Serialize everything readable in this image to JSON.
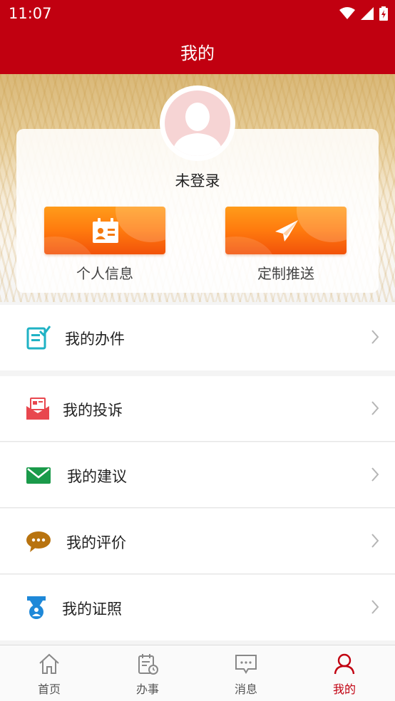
{
  "status_bar": {
    "time": "11:07"
  },
  "header": {
    "title": "我的"
  },
  "profile": {
    "login_status": "未登录"
  },
  "features": [
    {
      "label": "个人信息",
      "icon": "id-card-icon"
    },
    {
      "label": "定制推送",
      "icon": "paper-plane-icon"
    }
  ],
  "menu": [
    {
      "label": "我的办件",
      "icon": "edit-check-icon",
      "color": "#1fb2c4"
    },
    {
      "label": "我的投诉",
      "icon": "complaint-mail-icon",
      "color": "#e8474e"
    },
    {
      "label": "我的建议",
      "icon": "envelope-icon",
      "color": "#1a9a4a"
    },
    {
      "label": "我的评价",
      "icon": "chat-bubble-icon",
      "color": "#b8730f"
    },
    {
      "label": "我的证照",
      "icon": "certificate-badge-icon",
      "color": "#1e88d8"
    }
  ],
  "nav": [
    {
      "label": "首页",
      "icon": "home-icon"
    },
    {
      "label": "办事",
      "icon": "calendar-clock-icon"
    },
    {
      "label": "消息",
      "icon": "message-icon"
    },
    {
      "label": "我的",
      "icon": "user-icon",
      "active": true
    }
  ],
  "colors": {
    "brand_red": "#c10010",
    "orange": "#ff7a0e"
  }
}
